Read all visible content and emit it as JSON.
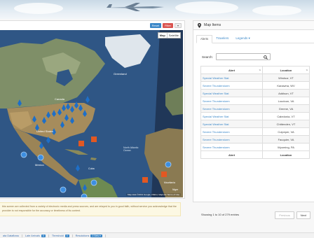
{
  "map": {
    "toolbar": {
      "reset": "Reset",
      "filter": "Filter",
      "more": "▾"
    },
    "map_type": {
      "map": "Map",
      "satellite": "Satellite"
    },
    "attribution": "Map data ©2013 Google, INEGI, MapLink  Terms of Use",
    "labels": [
      {
        "text": "Greenland"
      },
      {
        "text": "Canada"
      },
      {
        "text": "United States"
      },
      {
        "text": "Mexico"
      },
      {
        "text": "North Atlantic Ocean"
      },
      {
        "text": "Cuba"
      },
      {
        "text": "Mauritania"
      },
      {
        "text": "Niger"
      }
    ]
  },
  "disclaimer": "this screen are collected from a variety of electronic media and press sources, and are relayed to you in good faith, without service you acknowledge that the provider is not responsible for the accuracy or timeliness of its content.",
  "status_bar": {
    "items": [
      {
        "label": "ata Dataflows",
        "badge": ""
      },
      {
        "label": "Late Arrivals",
        "badge": "0"
      },
      {
        "label": "Threshold",
        "badge": "0"
      },
      {
        "label": "Resolutions",
        "badge": "2 Sets ▾"
      }
    ]
  },
  "panel": {
    "title": "Map Items",
    "tabs": [
      "Alerts",
      "Travelers",
      "Legends ▾"
    ],
    "search_label": "Search:",
    "search_value": "",
    "columns": [
      "Alert",
      "Location"
    ],
    "rows": [
      {
        "alert": "Special Weather Stat",
        "location": "Windsor, VT"
      },
      {
        "alert": "Severe Thunderstorm",
        "location": "Kanawha, WV"
      },
      {
        "alert": "Special Weather Stat",
        "location": "Addison, VT"
      },
      {
        "alert": "Severe Thunderstorm",
        "location": "Loudoun, VA"
      },
      {
        "alert": "Severe Thunderstorm",
        "location": "Greene, VA"
      },
      {
        "alert": "Special Weather Stat",
        "location": "Caledonia, VT"
      },
      {
        "alert": "Special Weather Stat",
        "location": "Chittenden, VT"
      },
      {
        "alert": "Severe Thunderstorm",
        "location": "Culpeper, VA"
      },
      {
        "alert": "Severe Thunderstorm",
        "location": "Fauquier, VA"
      },
      {
        "alert": "Severe Thunderstorm",
        "location": "Wyoming, PA"
      }
    ],
    "showing": "Showing 1 to 10 of 279 entries",
    "previous": "Previous",
    "next": "Next"
  }
}
